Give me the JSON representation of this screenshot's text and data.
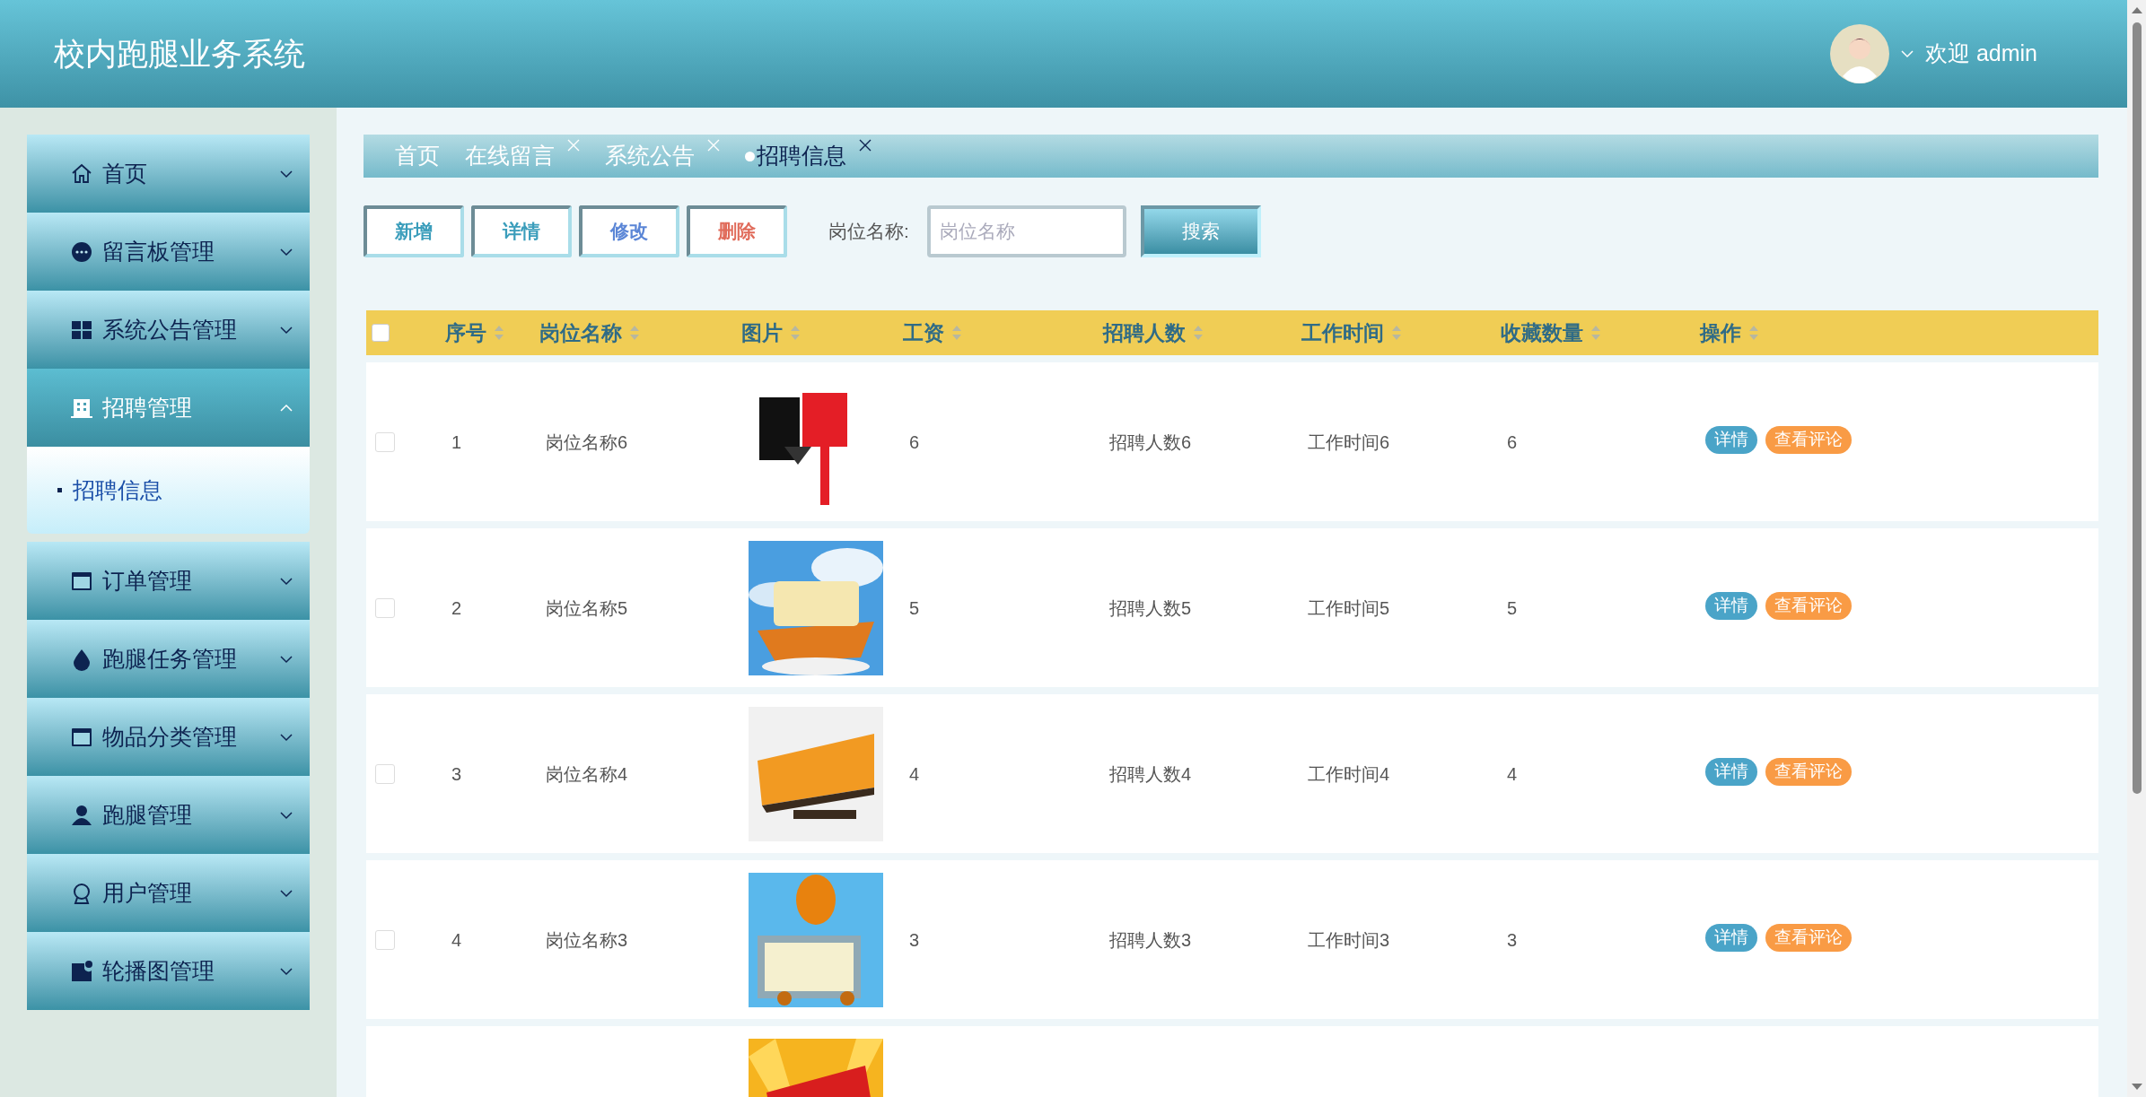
{
  "header": {
    "title": "校内跑腿业务系统",
    "greeting": "欢迎 admin"
  },
  "sidebar": {
    "items": [
      {
        "label": "首页",
        "expanded": false
      },
      {
        "label": "留言板管理",
        "expanded": false
      },
      {
        "label": "系统公告管理",
        "expanded": false
      },
      {
        "label": "招聘管理",
        "expanded": true,
        "children": [
          {
            "label": "招聘信息",
            "selected": true
          }
        ]
      },
      {
        "label": "订单管理",
        "expanded": false
      },
      {
        "label": "跑腿任务管理",
        "expanded": false
      },
      {
        "label": "物品分类管理",
        "expanded": false
      },
      {
        "label": "跑腿管理",
        "expanded": false
      },
      {
        "label": "用户管理",
        "expanded": false
      },
      {
        "label": "轮播图管理",
        "expanded": false
      }
    ]
  },
  "tabs": [
    {
      "label": "首页",
      "selected": false,
      "closable": false
    },
    {
      "label": "在线留言",
      "selected": false,
      "closable": true
    },
    {
      "label": "系统公告",
      "selected": false,
      "closable": true
    },
    {
      "label": "招聘信息",
      "selected": true,
      "closable": true
    }
  ],
  "toolbar": {
    "buttons": [
      {
        "label": "新增",
        "color": "#3a9dbb"
      },
      {
        "label": "详情",
        "color": "#3a9dbb"
      },
      {
        "label": "修改",
        "color": "#5b86d6"
      },
      {
        "label": "删除",
        "color": "#e06b5a"
      }
    ],
    "search_label": "岗位名称:",
    "search": {
      "placeholder": "岗位名称"
    },
    "search_button": "搜索"
  },
  "table": {
    "select_all": {
      "checked": false
    },
    "columns": [
      {
        "label": "序号",
        "sortable": true
      },
      {
        "label": "岗位名称",
        "sortable": true
      },
      {
        "label": "图片",
        "sortable": true
      },
      {
        "label": "工资",
        "sortable": true
      },
      {
        "label": "招聘人数",
        "sortable": true
      },
      {
        "label": "工作时间",
        "sortable": true
      },
      {
        "label": "收藏数量",
        "sortable": true
      },
      {
        "label": "操作",
        "sortable": true
      }
    ],
    "rows": [
      {
        "checked": false,
        "cells": [
          "1",
          "岗位名称6",
          "6",
          "招聘人数6",
          "工作时间6",
          "6"
        ],
        "actions": [
          "详情",
          "查看评论"
        ]
      },
      {
        "checked": false,
        "cells": [
          "2",
          "岗位名称5",
          "5",
          "招聘人数5",
          "工作时间5",
          "5"
        ],
        "actions": [
          "详情",
          "查看评论"
        ]
      },
      {
        "checked": false,
        "cells": [
          "3",
          "岗位名称4",
          "4",
          "招聘人数4",
          "工作时间4",
          "4"
        ],
        "actions": [
          "详情",
          "查看评论"
        ]
      },
      {
        "checked": false,
        "cells": [
          "4",
          "岗位名称3",
          "3",
          "招聘人数3",
          "工作时间3",
          "3"
        ],
        "actions": [
          "详情",
          "查看评论"
        ]
      },
      {}
    ]
  }
}
